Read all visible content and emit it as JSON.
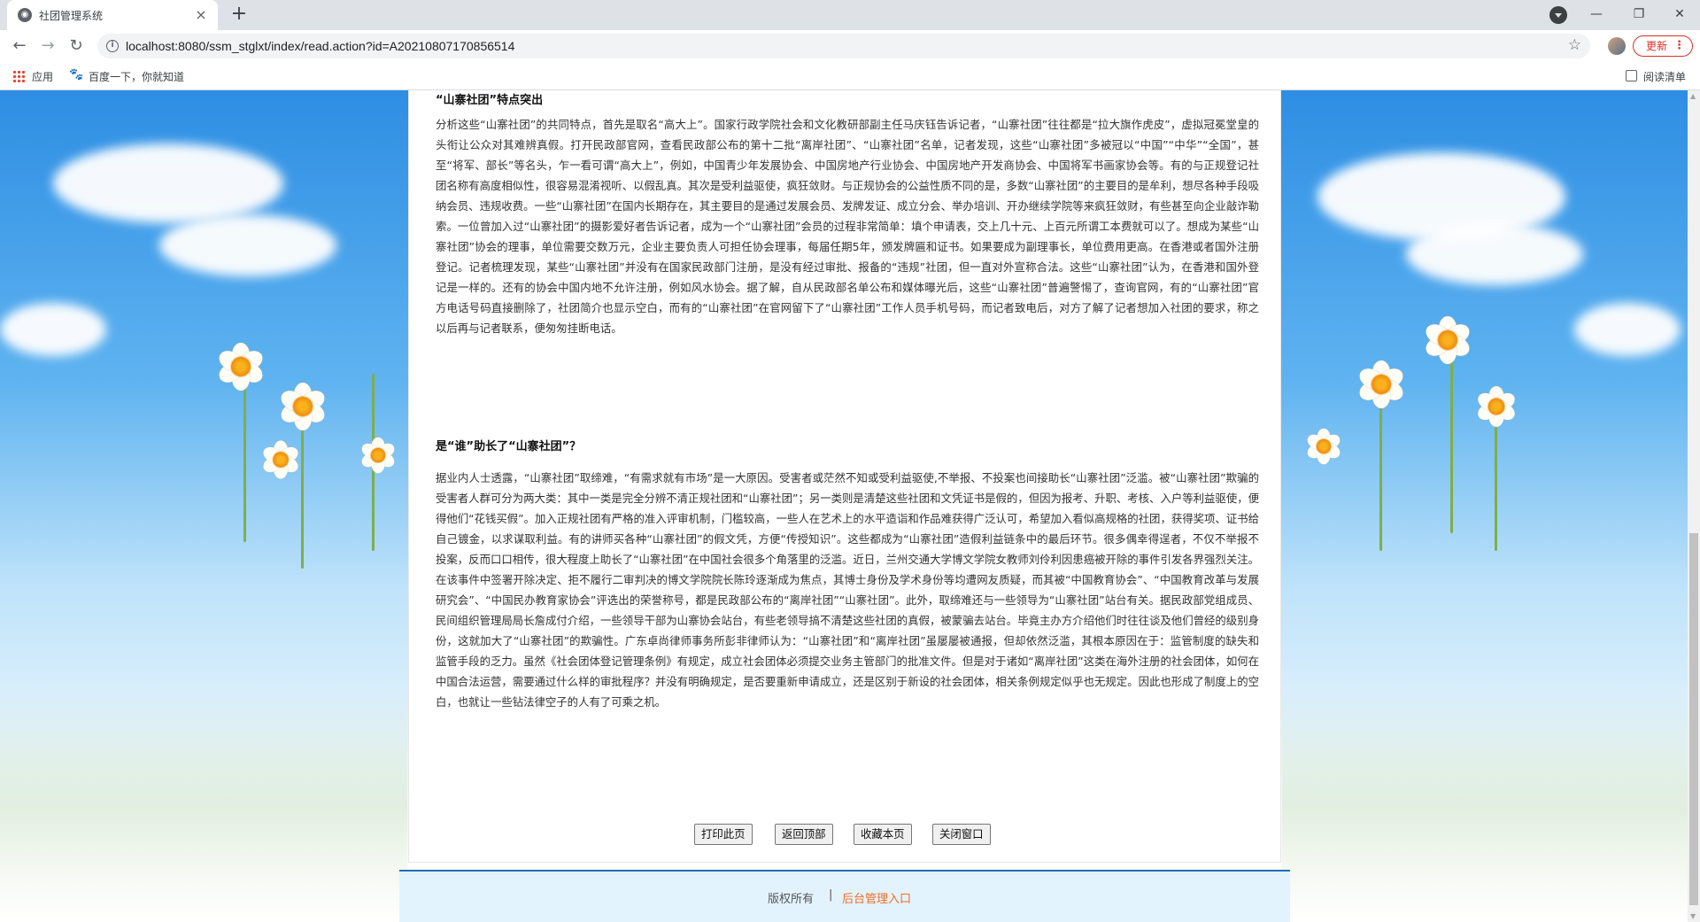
{
  "browser": {
    "tab_title": "社团管理系统",
    "tab_close": "×",
    "new_tab": "+",
    "url": "localhost:8080/ssm_stglxt/index/read.action?id=A20210807170856514",
    "update_label": "更新",
    "bookmarks": {
      "apps": "应用",
      "baidu": "百度一下，你就知道",
      "reading_list": "阅读清单"
    }
  },
  "article": {
    "heading1": "“山寨社团”特点突出",
    "para1": "分析这些“山寨社团”的共同特点，首先是取名“高大上”。国家行政学院社会和文化教研部副主任马庆钰告诉记者，“山寨社团”往往都是“拉大旗作虎皮”，虚拟冠冕堂皇的头衔让公众对其难辨真假。打开民政部官网，查看民政部公布的第十二批“离岸社团”、“山寨社团”名单，记者发现，这些“山寨社团”多被冠以“中国”“中华”“全国”，甚至“将军、部长”等名头，乍一看可谓“高大上”，例如，中国青少年发展协会、中国房地产行业协会、中国房地产开发商协会、中国将军书画家协会等。有的与正规登记社团名称有高度相似性，很容易混淆视听、以假乱真。其次是受利益驱使，疯狂敛财。与正规协会的公益性质不同的是，多数“山寨社团”的主要目的是牟利，想尽各种手段吸纳会员、违规收费。一些“山寨社团”在国内长期存在，其主要目的是通过发展会员、发牌发证、成立分会、举办培训、开办继续学院等来疯狂敛财，有些甚至向企业敲诈勒索。一位曾加入过“山寨社团”的摄影爱好者告诉记者，成为一个“山寨社团”会员的过程非常简单：填个申请表，交上几十元、上百元所谓工本费就可以了。想成为某些“山寨社团”协会的理事，单位需要交数万元，企业主要负责人可担任协会理事，每届任期5年，颁发牌匾和证书。如果要成为副理事长，单位费用更高。在香港或者国外注册登记。记者梳理发现，某些“山寨社团”并没有在国家民政部门注册，是没有经过审批、报备的“违规”社团，但一直对外宣称合法。这些“山寨社团”认为，在香港和国外登记是一样的。还有的协会中国内地不允许注册，例如风水协会。据了解，自从民政部名单公布和媒体曝光后，这些“山寨社团”普遍警惕了，查询官网，有的“山寨社团”官方电话号码直接删除了，社团简介也显示空白，而有的“山寨社团”在官网留下了“山寨社团”工作人员手机号码，而记者致电后，对方了解了记者想加入社团的要求，称之以后再与记者联系，便匆匆挂断电话。",
    "heading2": "是“谁”助长了“山寨社团”？",
    "para2": "据业内人士透露，“山寨社团”取缔难，“有需求就有市场”是一大原因。受害者或茫然不知或受利益驱使,不举报、不投案也间接助长“山寨社团”泛滥。被“山寨社团”欺骗的受害者人群可分为两大类：其中一类是完全分辨不清正规社团和“山寨社团”；另一类则是清楚这些社团和文凭证书是假的，但因为报考、升职、考核、入户等利益驱使，便得他们“花钱买假”。加入正规社团有严格的准入评审机制，门槛较高，一些人在艺术上的水平造诣和作品难获得广泛认可，希望加入看似高规格的社团，获得奖项、证书给自己镀金，以求谋取利益。有的讲师买各种“山寨社团”的假文凭，方便“传授知识”。这些都成为“山寨社团”造假利益链条中的最后环节。很多偶幸得逞者，不仅不举报不投案，反而口口相传，很大程度上助长了“山寨社团”在中国社会很多个角落里的泛滥。近日，兰州交通大学博文学院女教师刘伶利因患癌被开除的事件引发各界强烈关注。在该事件中签署开除决定、拒不履行二审判决的博文学院院长陈玲逐渐成为焦点，其博士身份及学术身份等均遭网友质疑，而其被“中国教育协会”、“中国教育改革与发展研究会”、“中国民办教育家协会”评选出的荣誉称号，都是民政部公布的“离岸社团”“山寨社团”。此外，取缔难还与一些领导为“山寨社团”站台有关。据民政部党组成员、民间组织管理局局长詹成付介绍，一些领导干部为山寨协会站台，有些老领导搞不清楚这些社团的真假，被蒙骗去站台。毕竟主办方介绍他们时往往谈及他们曾经的级别身份，这就加大了“山寨社团”的欺骗性。广东卓尚律师事务所彭非律师认为：“山寨社团”和“离岸社团”虽屡屡被通报，但却依然泛滥，其根本原因在于：监管制度的缺失和监管手段的乏力。虽然《社会团体登记管理条例》有规定，成立社会团体必须提交业务主管部门的批准文件。但是对于诸如“离岸社团”这类在海外注册的社会团体，如何在中国合法运营，需要通过什么样的审批程序？并没有明确规定，是否要重新申请成立，还是区别于新设的社会团体，相关条例规定似乎也无规定。因此也形成了制度上的空白，也就让一些钻法律空子的人有了可乘之机。"
  },
  "actions": {
    "print": "打印此页",
    "back_top": "返回顶部",
    "bookmark": "收藏本页",
    "close": "关闭窗口"
  },
  "footer": {
    "copyright": "版权所有",
    "separator": "|",
    "admin_link": "后台管理入口"
  }
}
